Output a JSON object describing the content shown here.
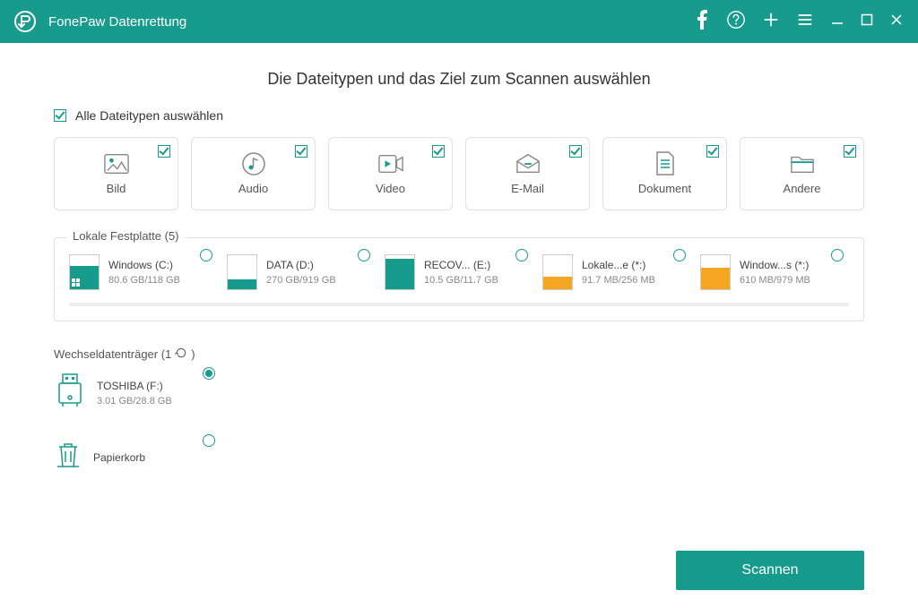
{
  "app": {
    "title": "FonePaw Datenrettung"
  },
  "page": {
    "title": "Die Dateitypen und das Ziel zum Scannen auswählen",
    "select_all_label": "Alle Dateitypen auswählen"
  },
  "filetypes": [
    {
      "id": "image",
      "label": "Bild",
      "checked": true
    },
    {
      "id": "audio",
      "label": "Audio",
      "checked": true
    },
    {
      "id": "video",
      "label": "Video",
      "checked": true
    },
    {
      "id": "email",
      "label": "E-Mail",
      "checked": true
    },
    {
      "id": "document",
      "label": "Dokument",
      "checked": true
    },
    {
      "id": "other",
      "label": "Andere",
      "checked": true
    }
  ],
  "local_disk_section": {
    "legend": "Lokale Festplatte (5)"
  },
  "drives": [
    {
      "name": "Windows (C:)",
      "size": "80.6 GB/118 GB",
      "fill_pct": 68,
      "color": "#179b8d",
      "is_windows": true
    },
    {
      "name": "DATA (D:)",
      "size": "270 GB/919 GB",
      "fill_pct": 29,
      "color": "#179b8d",
      "is_windows": false
    },
    {
      "name": "RECOV... (E:)",
      "size": "10.5 GB/11.7 GB",
      "fill_pct": 90,
      "color": "#179b8d",
      "is_windows": false
    },
    {
      "name": "Lokale...e (*:)",
      "size": "91.7 MB/256 MB",
      "fill_pct": 36,
      "color": "#f5a623",
      "is_windows": false
    },
    {
      "name": "Window...s (*:)",
      "size": "610 MB/979 MB",
      "fill_pct": 62,
      "color": "#f5a623",
      "is_windows": false
    }
  ],
  "removable_section": {
    "title": "Wechseldatenträger (1",
    "refresh_suffix": ")"
  },
  "removable": {
    "name": "TOSHIBA (F:)",
    "size": "3.01 GB/28.8 GB",
    "selected": true
  },
  "recycle": {
    "label": "Papierkorb",
    "selected": false
  },
  "scan_button": "Scannen",
  "colors": {
    "accent": "#179b8d",
    "warn": "#f5a623"
  }
}
